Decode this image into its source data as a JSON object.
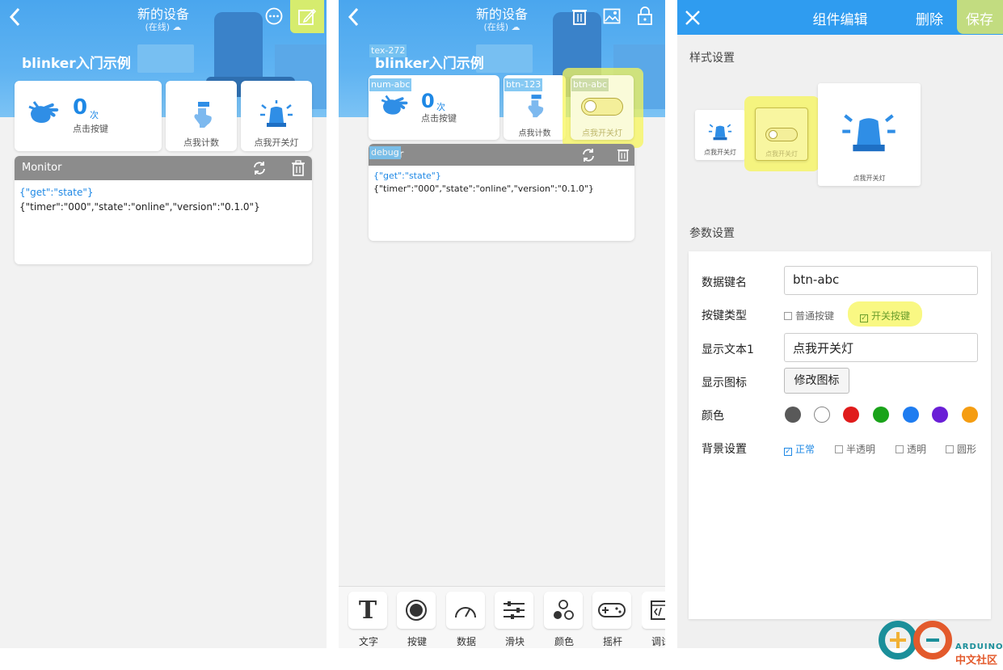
{
  "panel1": {
    "title": "新的设备",
    "subtitle": "(在线)",
    "heading": "blinker入门示例",
    "counter": {
      "value": "0",
      "unit": "次",
      "label": "点击按键"
    },
    "btn1_label": "点我计数",
    "btn2_label": "点我开关灯",
    "monitor": {
      "title": "Monitor",
      "line1": "{\"get\":\"state\"}",
      "line2": "{\"timer\":\"000\",\"state\":\"online\",\"version\":\"0.1.0\"}"
    }
  },
  "panel2": {
    "title": "新的设备",
    "subtitle": "(在线)",
    "heading": "blinker入门示例",
    "tags": {
      "text": "tex-272",
      "num": "num-abc",
      "btn1": "btn-123",
      "btn2": "btn-abc",
      "debug": "debug"
    },
    "counter": {
      "value": "0",
      "unit": "次",
      "label": "点击按键"
    },
    "btn1_label": "点我计数",
    "btn2_label": "点我开关灯",
    "monitor": {
      "title_fragment": "or",
      "line1": "{\"get\":\"state\"}",
      "line2": "{\"timer\":\"000\",\"state\":\"online\",\"version\":\"0.1.0\"}"
    },
    "tools": [
      {
        "label": "文字",
        "icon": "text-icon"
      },
      {
        "label": "按键",
        "icon": "button-icon"
      },
      {
        "label": "数据",
        "icon": "gauge-icon"
      },
      {
        "label": "滑块",
        "icon": "slider-icon"
      },
      {
        "label": "颜色",
        "icon": "color-icon"
      },
      {
        "label": "摇杆",
        "icon": "joystick-icon"
      },
      {
        "label": "调试",
        "icon": "debug-icon"
      }
    ]
  },
  "panel3": {
    "title": "组件编辑",
    "delete_label": "删除",
    "save_label": "保存",
    "style_section": "样式设置",
    "style_preview": {
      "small_label": "点我开关灯",
      "mid_label": "点我开关灯",
      "large_label": "点我开关灯"
    },
    "param_section": "参数设置",
    "fields": {
      "key_label": "数据键名",
      "key_value": "btn-abc",
      "type_label": "按键类型",
      "type_option1": "普通按键",
      "type_option2": "开关按键",
      "text_label": "显示文本1",
      "text_value": "点我开关灯",
      "icon_label": "显示图标",
      "icon_button": "修改图标",
      "color_label": "颜色",
      "colors": [
        "#595959",
        "#ffffff",
        "#e01b1b",
        "#1aa31a",
        "#1e7cf0",
        "#6a1fd6",
        "#f59d12"
      ],
      "bg_label": "背景设置",
      "bg_options": [
        "正常",
        "半透明",
        "透明",
        "圆形"
      ]
    }
  },
  "logo": {
    "line1": "ARDUINO",
    "line2": "中文社区"
  }
}
